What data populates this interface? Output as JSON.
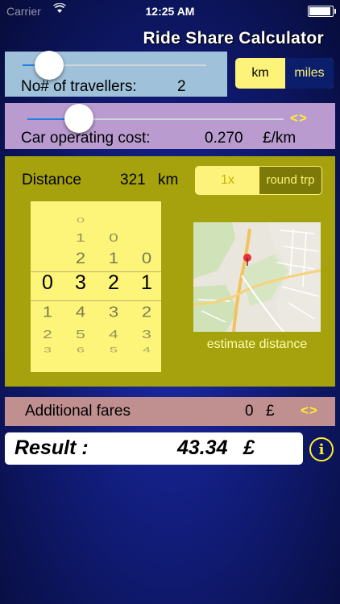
{
  "status_bar": {
    "carrier": "Carrier",
    "time": "12:25 AM"
  },
  "app_title": "Ride Share Calculator",
  "travellers": {
    "label": "No# of travellers:",
    "value": "2",
    "slider_fraction": 0.18
  },
  "units": {
    "options": [
      "km",
      "miles"
    ],
    "selected": "miles"
  },
  "car_cost": {
    "label": "Car operating cost:",
    "value": "0.270",
    "unit": "£/km",
    "slider_fraction": 0.2,
    "arrows": "<>"
  },
  "distance": {
    "label": "Distance",
    "value": "321",
    "unit": "km",
    "trip_options": [
      "1x",
      "round trp"
    ],
    "selected_trip": "round trp",
    "picker_digits": [
      [
        "",
        "",
        "",
        "0",
        "1",
        "2",
        "3"
      ],
      [
        "0",
        "1",
        "2",
        "3",
        "4",
        "5",
        "6"
      ],
      [
        "",
        "0",
        "1",
        "2",
        "3",
        "4",
        "5"
      ],
      [
        "",
        "",
        "0",
        "1",
        "2",
        "3",
        "4"
      ]
    ],
    "estimate_label": "estimate distance"
  },
  "fares": {
    "label": "Additional fares",
    "value": "0",
    "unit": "£",
    "arrows": "<>"
  },
  "result": {
    "label": "Result :",
    "value": "43.34",
    "unit": "£"
  },
  "info_label": "i",
  "colors": {
    "accent": "#ffee30",
    "segment_fill": "#fdf27a",
    "dark_navy": "#0b1e6b"
  }
}
